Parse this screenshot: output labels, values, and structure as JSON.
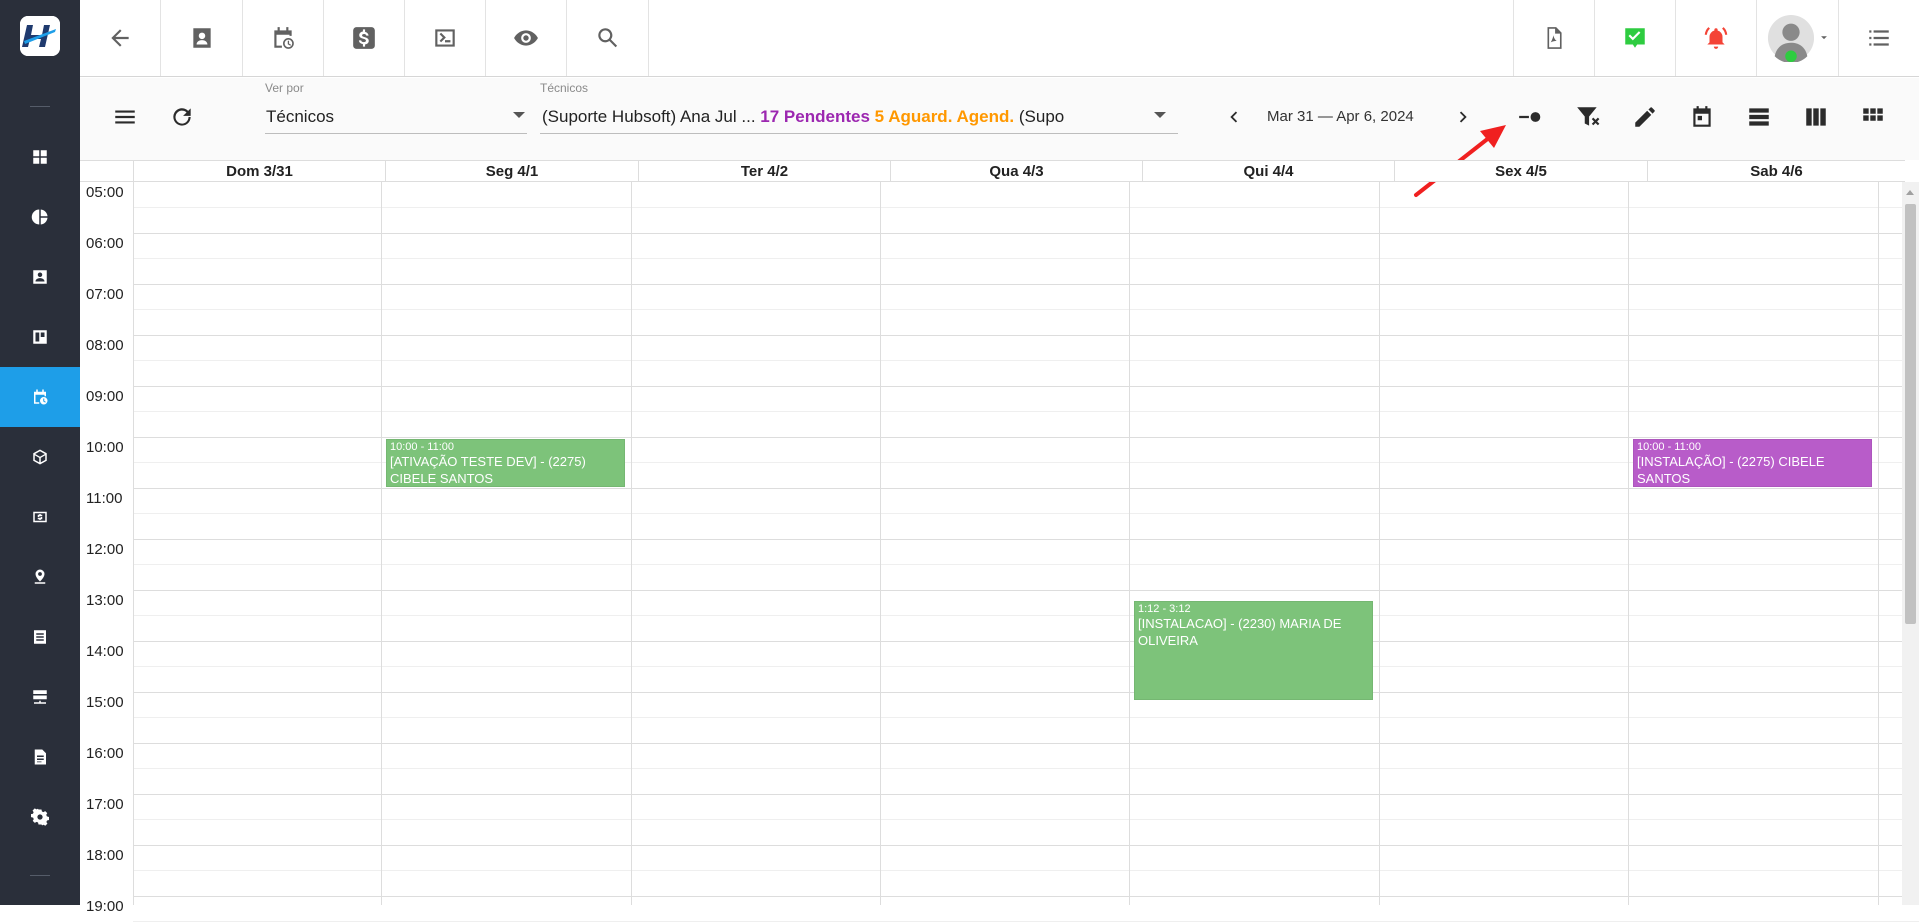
{
  "app": {
    "sidebar_icons": [
      "dashboard-icon",
      "pie-chart-icon",
      "contact-icon",
      "board-icon",
      "calendar-clock-icon",
      "package-icon",
      "money-icon",
      "map-pin-icon",
      "list-icon",
      "server-icon",
      "document-icon",
      "settings-icon"
    ],
    "active_item": "calendar-clock-icon"
  },
  "topbar": {
    "icons": [
      "back-arrow-icon",
      "contact-card-icon",
      "calendar-clock-icon",
      "dollar-icon",
      "terminal-icon",
      "eye-icon",
      "search-icon"
    ],
    "right_icons": [
      "pdf-icon",
      "check-badge-icon",
      "alarm-bell-icon",
      "avatar",
      "menu-list-icon"
    ],
    "colors": {
      "check": "#2ecc40",
      "alarm": "#f44336"
    }
  },
  "toolbar": {
    "view_by_label": "Ver por",
    "view_by_value": "Técnicos",
    "tech_label": "Técnicos",
    "tech_value_prefix": "(Suporte Hubsoft) Ana Jul ...",
    "pending": "17 Pendentes",
    "awaiting": "5 Aguard. Agend.",
    "tech_value_suffix": "(Supo",
    "date_range": "Mar 31 — Apr 6, 2024"
  },
  "calendar": {
    "days": [
      "Dom 3/31",
      "Seg 4/1",
      "Ter 4/2",
      "Qua 4/3",
      "Qui 4/4",
      "Sex 4/5",
      "Sab 4/6"
    ],
    "hours": [
      "05:00",
      "06:00",
      "07:00",
      "08:00",
      "09:00",
      "10:00",
      "11:00",
      "12:00",
      "13:00",
      "14:00",
      "15:00",
      "16:00",
      "17:00",
      "18:00",
      "19:00"
    ],
    "events": [
      {
        "time": "10:00 - 11:00",
        "title": "[ATIVAÇÃO TESTE DEV] - (2275) CIBELE SANTOS",
        "color": "#7dc37a"
      },
      {
        "time": "10:00 - 11:00",
        "title": "[INSTALAÇÃO] - (2275) CIBELE SANTOS",
        "color": "#b85cc9"
      },
      {
        "time": "1:12 - 3:12",
        "title": "[INSTALACAO] - (2230) MARIA DE OLIVEIRA",
        "color": "#7dc37a"
      }
    ]
  },
  "annotation": {
    "arrow_color": "#f02020"
  }
}
